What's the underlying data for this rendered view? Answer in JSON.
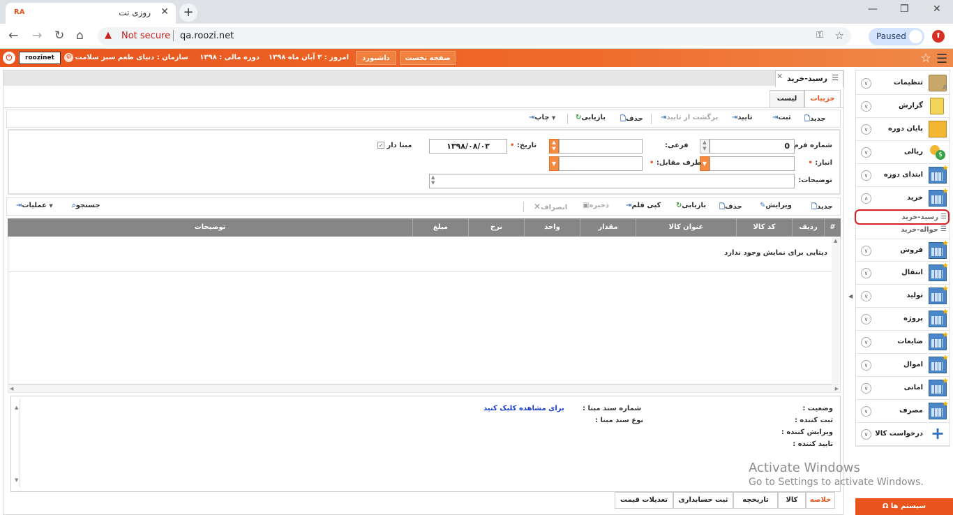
{
  "browser": {
    "tab_title": "روزی نت",
    "favicon_text": "RA",
    "security_label": "Not secure",
    "url": "qa.roozi.net",
    "profile_label": "Paused"
  },
  "app_header": {
    "username": "roozinet",
    "org_label": "سازمان :",
    "org_value": "دنیای طعم سبز سلامت",
    "period_label": "دوره مالی :",
    "period_value": "۱۳۹۸",
    "today_label": "امروز :",
    "today_value": "۳ آبان ماه ۱۳۹۸",
    "dashboard_label": "داشبورد",
    "home_label": "صفحه نخست"
  },
  "page_tab": {
    "title": "رسید-خرید"
  },
  "view_tabs": {
    "details": "جزییات",
    "list": "لیست"
  },
  "main_toolbar": {
    "new": "جدید",
    "save": "ثبت",
    "approve": "تایید",
    "unapprove": "برگشت از تایید",
    "delete": "حذف",
    "reload": "بازیابی",
    "print": "چاپ"
  },
  "form": {
    "form_number_label": "شماره فرم:",
    "form_number_value": "0",
    "sub_label": "فرعی:",
    "sub_value": "",
    "date_label": "تاریخ:",
    "date_value": "۱۳۹۸/۰۸/۰۳",
    "based_label": "مبنا دار",
    "warehouse_label": "انبار:",
    "warehouse_value": "",
    "counterparty_label": "طرف مقابل:",
    "counterparty_value": "",
    "description_label": "توضیحات:",
    "description_value": ""
  },
  "grid_toolbar": {
    "new": "جدید",
    "edit": "ویرایش",
    "delete": "حذف",
    "reload": "بازیابی",
    "copy_row": "کپی قلم",
    "save": "ذخیره",
    "cancel": "انصراف",
    "search": "جستجو",
    "operations": "عملیات"
  },
  "grid": {
    "columns": [
      "#",
      "ردیف",
      "کد کالا",
      "عنوان کالا",
      "مقدار",
      "واحد",
      "نرخ",
      "مبلغ",
      "توضیحات"
    ],
    "empty_message": "دیتایی برای نمایش وجود ندارد"
  },
  "info": {
    "status_label": "وضعیت :",
    "creator_label": "ثبت کننده :",
    "editor_label": "ویرایش کننده :",
    "approver_label": "تایید کننده :",
    "base_doc_no_label": "شماره سند مبنا :",
    "base_doc_type_label": "نوع سند مبنا :",
    "view_link": "برای مشاهده کلیک کنید"
  },
  "bottom_tabs": [
    "خلاصه",
    "کالا",
    "تاریخچه",
    "ثبت حسابداری",
    "تعدیلات قیمت"
  ],
  "sidebar": {
    "items": [
      {
        "label": "تنظیمات",
        "icon": "settings-icon"
      },
      {
        "label": "گزارش",
        "icon": "clipboard-icon"
      },
      {
        "label": "پایان دوره",
        "icon": "folders-icon"
      },
      {
        "label": "ریالی",
        "icon": "coins-icon"
      },
      {
        "label": "ابتدای دوره",
        "icon": "grid-icon"
      },
      {
        "label": "خرید",
        "icon": "grid-icon"
      },
      {
        "label": "فروش",
        "icon": "grid-icon"
      },
      {
        "label": "انتقال",
        "icon": "grid-icon"
      },
      {
        "label": "تولید",
        "icon": "grid-icon"
      },
      {
        "label": "پروژه",
        "icon": "grid-icon"
      },
      {
        "label": "ضایعات",
        "icon": "grid-icon"
      },
      {
        "label": "اموال",
        "icon": "grid-icon"
      },
      {
        "label": "امانی",
        "icon": "grid-icon"
      },
      {
        "label": "مصرف",
        "icon": "grid-icon"
      },
      {
        "label": "درخواست کالا",
        "icon": "plus-icon"
      }
    ],
    "sub_items": [
      "رسید-خرید",
      "حواله-خرید"
    ],
    "system_button": "سیستم ها"
  },
  "watermark": {
    "line1": "Activate Windows",
    "line2": "Go to Settings to activate Windows."
  },
  "colors": {
    "accent": "#e8541c",
    "grid_header": "#868686",
    "link": "#1a3fcf"
  }
}
